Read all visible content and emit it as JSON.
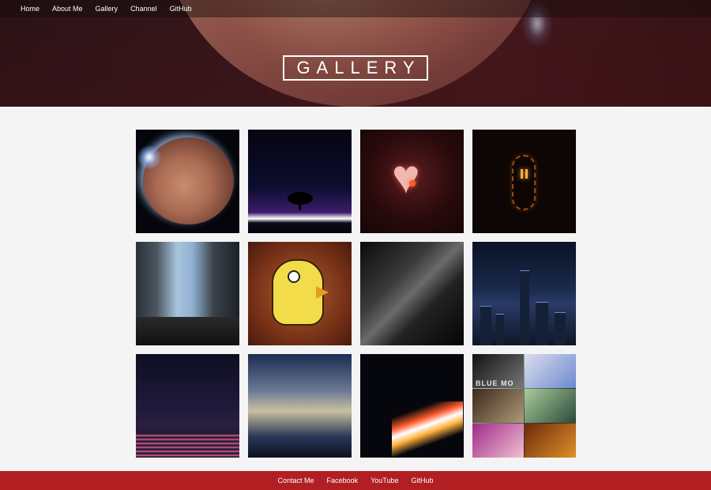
{
  "nav": {
    "items": [
      {
        "label": "Home"
      },
      {
        "label": "About Me"
      },
      {
        "label": "Gallery"
      },
      {
        "label": "Channel"
      },
      {
        "label": "GitHub"
      }
    ]
  },
  "hero": {
    "title": "GALLERY"
  },
  "gallery": {
    "tiles": [
      {
        "icon": "planet-image"
      },
      {
        "icon": "tree-silhouette-image"
      },
      {
        "icon": "music-heart-image"
      },
      {
        "icon": "lightbulb-image"
      },
      {
        "icon": "city-street-image"
      },
      {
        "icon": "yellow-bird-image"
      },
      {
        "icon": "piano-image"
      },
      {
        "icon": "hong-kong-skyline-image"
      },
      {
        "icon": "harbor-night-image"
      },
      {
        "icon": "cloudy-harbor-image"
      },
      {
        "icon": "traffic-lights-image"
      },
      {
        "icon": "collage-image",
        "text": "BLUE MO"
      }
    ]
  },
  "footer": {
    "links": [
      {
        "label": "Contact Me"
      },
      {
        "label": "Facebook"
      },
      {
        "label": "YouTube"
      },
      {
        "label": "GitHub"
      }
    ]
  },
  "colors": {
    "footer_bg": "#b11f23",
    "page_bg": "#f4f4f4"
  }
}
